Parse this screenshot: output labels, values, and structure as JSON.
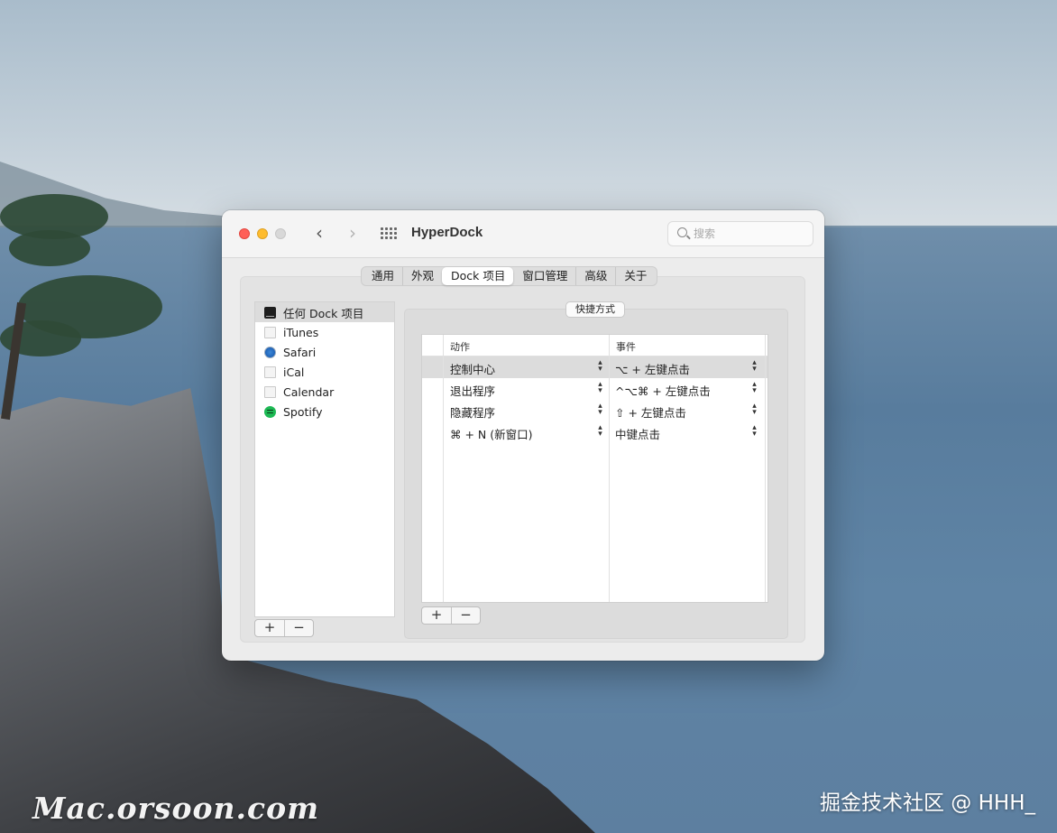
{
  "window": {
    "title": "HyperDock",
    "search_placeholder": "搜索"
  },
  "tabs": [
    {
      "label": "通用",
      "active": false
    },
    {
      "label": "外观",
      "active": false
    },
    {
      "label": "Dock 项目",
      "active": true
    },
    {
      "label": "窗口管理",
      "active": false
    },
    {
      "label": "高级",
      "active": false
    },
    {
      "label": "关于",
      "active": false
    }
  ],
  "dock_items": [
    {
      "label": "任何 Dock 项目",
      "icon": "dock-icon",
      "selected": true
    },
    {
      "label": "iTunes",
      "icon": "document-icon",
      "selected": false
    },
    {
      "label": "Safari",
      "icon": "safari-icon",
      "selected": false
    },
    {
      "label": "iCal",
      "icon": "document-icon",
      "selected": false
    },
    {
      "label": "Calendar",
      "icon": "document-icon",
      "selected": false
    },
    {
      "label": "Spotify",
      "icon": "spotify-icon",
      "selected": false
    }
  ],
  "shortcuts": {
    "group_label": "快捷方式",
    "columns": {
      "action": "动作",
      "event": "事件"
    },
    "rows": [
      {
        "action": "控制中心",
        "event": "⌥ + 左键点击",
        "selected": true
      },
      {
        "action": "退出程序",
        "event": "^⌥⌘ + 左键点击",
        "selected": false
      },
      {
        "action": "隐藏程序",
        "event": "⇧ + 左键点击",
        "selected": false
      },
      {
        "action": "⌘ + N (新窗口)",
        "event": "中键点击",
        "selected": false
      }
    ]
  },
  "buttons": {
    "add": "+",
    "remove": "−"
  },
  "watermarks": {
    "left": "Mac.orsoon.com",
    "right": "掘金技术社区 @ HHH_"
  },
  "colors": {
    "close": "#ff5f57",
    "minimize": "#febc2e",
    "zoom_disabled": "#d8d8d8",
    "spotify": "#1db954"
  }
}
